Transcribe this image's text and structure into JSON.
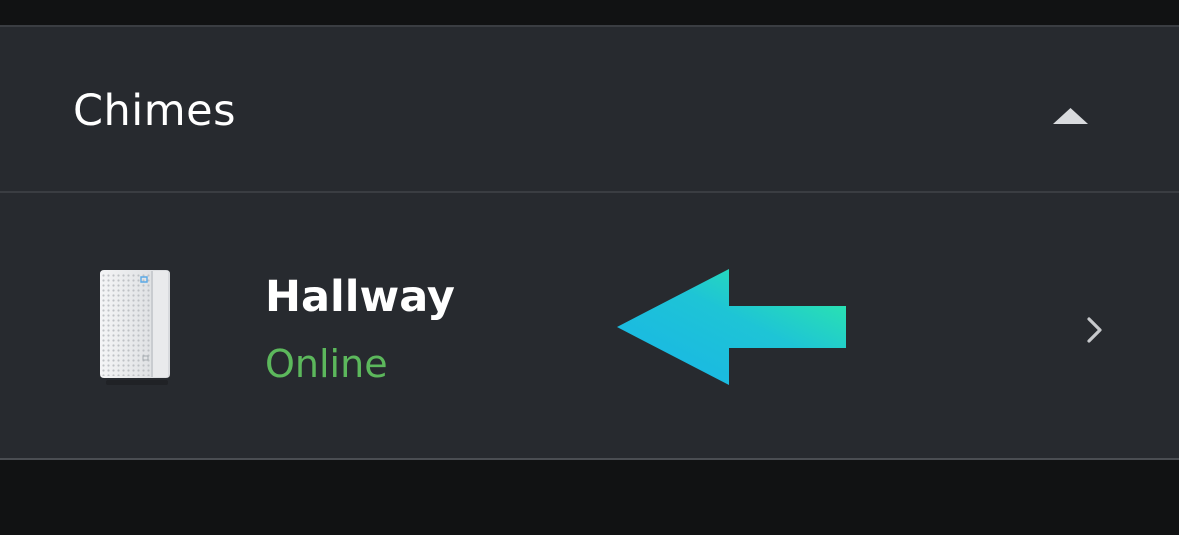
{
  "section": {
    "title": "Chimes",
    "collapse_icon": "chevron-up-icon"
  },
  "device": {
    "name": "Hallway",
    "status": "Online",
    "status_color": "#5cb85c",
    "image_icon": "chime-device-icon",
    "nav_icon": "chevron-right-icon"
  },
  "annotation": {
    "icon": "arrow-left-icon",
    "gradient": [
      "#18b4e8",
      "#2ff0a0"
    ]
  }
}
